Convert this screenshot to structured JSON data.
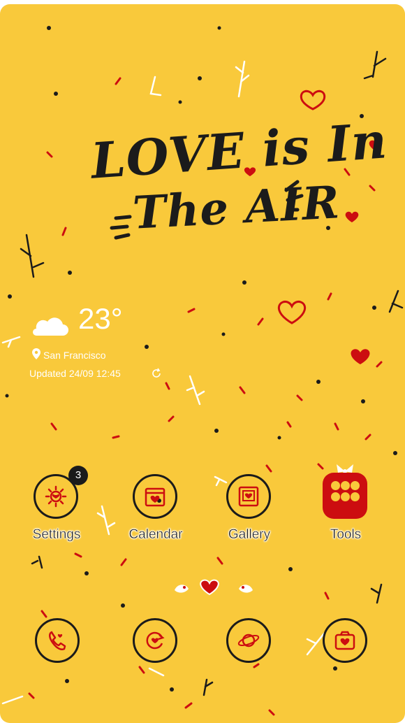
{
  "wallpaper": {
    "title_line1": "LOVE is In",
    "title_line2": "The AIR",
    "accent_color": "#cc0d10",
    "background_color": "#f9c93b"
  },
  "weather": {
    "temperature": "23°",
    "location": "San Francisco",
    "updated": "Updated 24/09 12:45",
    "icon": "cloud-icon"
  },
  "apps_row1": [
    {
      "label": "Settings",
      "icon": "sun-gear-icon",
      "badge": "3"
    },
    {
      "label": "Calendar",
      "icon": "calendar-heart-icon"
    },
    {
      "label": "Gallery",
      "icon": "picture-heart-icon"
    },
    {
      "label": "Tools",
      "icon": "tools-folder-icon"
    }
  ],
  "dock": [
    {
      "icon": "phone-icon"
    },
    {
      "icon": "internet-heart-icon"
    },
    {
      "icon": "planet-icon"
    },
    {
      "icon": "camera-heart-icon"
    }
  ],
  "page_indicator": {
    "pages": 3,
    "current_index": 1
  }
}
